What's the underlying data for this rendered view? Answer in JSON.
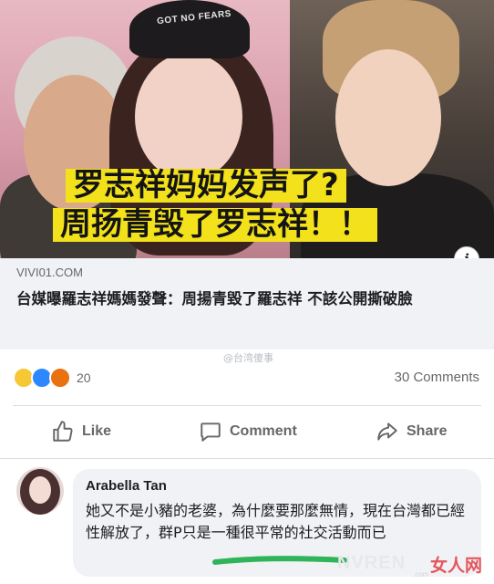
{
  "hero": {
    "cap_text": "GOT NO FEARS",
    "overlay_line1": "罗志祥妈妈发声了?",
    "overlay_line2": "周扬青毁了罗志祥！！",
    "info_icon": "i"
  },
  "link_preview": {
    "domain": "VIVI01.COM",
    "headline": "台媒曝羅志祥媽媽發聲：周揚青毀了羅志祥 不該公開撕破臉"
  },
  "watermark_top": "@台湾傻事",
  "reactions": {
    "icons": [
      "haha-icon",
      "like-icon",
      "angry-icon"
    ],
    "count": "20",
    "comments_count": "30 Comments"
  },
  "actions": {
    "like_label": "Like",
    "comment_label": "Comment",
    "share_label": "Share"
  },
  "comment": {
    "author": "Arabella Tan",
    "text": "她又不是小豬的老婆，為什麼要那麼無情，現在台灣都已經性解放了，群P只是一種很平常的社交活動而已"
  },
  "watermark_bottom": {
    "brand": "NVREN",
    "brand_sub": ".com",
    "brand_cn": "女人网"
  },
  "colors": {
    "overlay_bg": "#f2e11b",
    "accent_blue": "#2d88ff",
    "underline_green": "#2fb45a"
  }
}
